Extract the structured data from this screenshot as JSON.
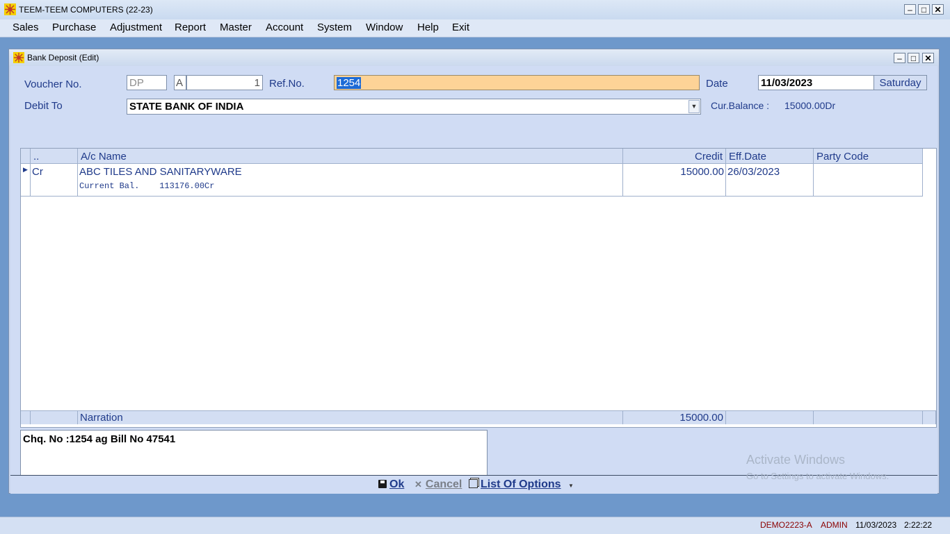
{
  "app": {
    "title": "TEEM-TEEM COMPUTERS (22-23)"
  },
  "menu": [
    "Sales",
    "Purchase",
    "Adjustment",
    "Report",
    "Master",
    "Account",
    "System",
    "Window",
    "Help",
    "Exit"
  ],
  "window": {
    "title": "Bank Deposit (Edit)",
    "voucher_label": "Voucher No.",
    "voucher_prefix": "DP",
    "voucher_series": "A",
    "voucher_number": "1",
    "ref_label": "Ref.No.",
    "ref_value": "1254",
    "date_label": "Date",
    "date_value": "11/03/2023",
    "day": "Saturday",
    "debit_label": "Debit To",
    "debit_value": "STATE BANK OF INDIA",
    "cur_balance_label": "Cur.Balance :",
    "cur_balance_value": "15000.00Dr"
  },
  "grid": {
    "headers": [
      "..",
      "A/c Name",
      "Credit",
      "Eff.Date",
      "Party Code"
    ],
    "rows": [
      {
        "type": "Cr",
        "name": "ABC TILES AND SANITARYWARE",
        "sub": "Current Bal.    113176.00Cr",
        "credit": "15000.00",
        "eff_date": "26/03/2023",
        "party_code": ""
      }
    ],
    "footer": {
      "label": "Narration",
      "total": "15000.00"
    }
  },
  "narration_text": "Chq. No :1254 ag Bill No 47541",
  "actions": {
    "ok": "Ok",
    "cancel": "Cancel",
    "list": "List Of Options"
  },
  "watermark": {
    "line1": "Activate Windows",
    "line2": "Go to Settings to activate Windows."
  },
  "status": {
    "company": "DEMO2223-A",
    "user": "ADMIN",
    "date": "11/03/2023",
    "time": "2:22:22"
  }
}
